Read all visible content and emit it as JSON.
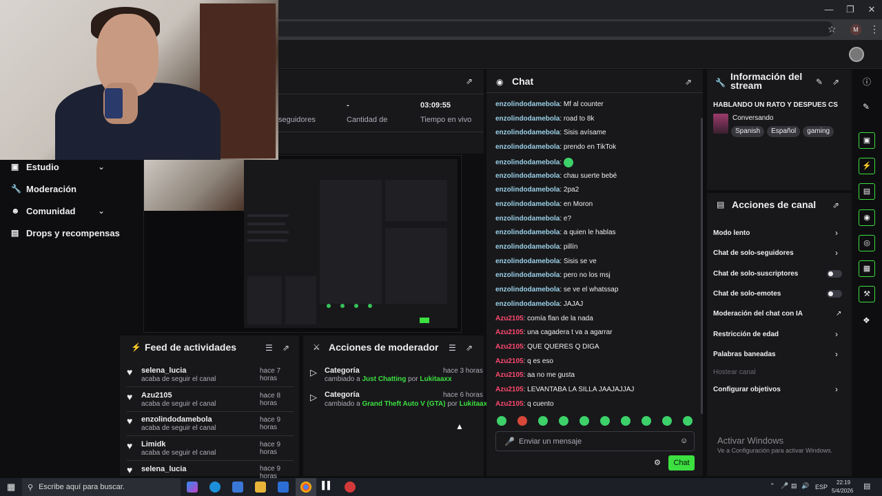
{
  "nav": {
    "items": [
      {
        "label": "Estudio",
        "icon": "film-icon",
        "chevron": true
      },
      {
        "label": "Moderación",
        "icon": "wrench-icon",
        "chevron": false
      },
      {
        "label": "Comunidad",
        "icon": "people-icon",
        "chevron": true
      },
      {
        "label": "Drops y recompensas",
        "icon": "chart-icon",
        "chevron": false
      }
    ]
  },
  "stats": {
    "followers_label": "seguidores",
    "subs_value": "-",
    "subs_label": "Cantidad de suscripciones",
    "live_time": "03:09:55",
    "live_label": "Tiempo en vivo"
  },
  "feed": {
    "title": "Feed de actividades",
    "items": [
      {
        "name": "selena_lucia",
        "action": "acaba de seguir el canal",
        "time": "hace 7 horas"
      },
      {
        "name": "Azu2105",
        "action": "acaba de seguir el canal",
        "time": "hace 8 horas"
      },
      {
        "name": "enzolindodamebola",
        "action": "acaba de seguir el canal",
        "time": "hace 9 horas"
      },
      {
        "name": "Limidk",
        "action": "acaba de seguir el canal",
        "time": "hace 9 horas"
      },
      {
        "name": "selena_lucia",
        "action": "",
        "time": "hace 9 horas"
      }
    ]
  },
  "modactions": {
    "title": "Acciones de moderador",
    "items": [
      {
        "type": "Categoría",
        "prefix": "cambiado a ",
        "target": "Just Chatting",
        "by": " por ",
        "mod": "Lukitaaxx",
        "time": "hace 3 horas"
      },
      {
        "type": "Categoría",
        "prefix": "cambiado a ",
        "target": "Grand Theft Auto V (GTA)",
        "by": " por ",
        "mod": "Lukitaaxx",
        "time": "hace 6 horas"
      }
    ]
  },
  "chat": {
    "title": "Chat",
    "messages": [
      {
        "user": "enzolindodamebola",
        "text": "Mf al counter",
        "u": 1
      },
      {
        "user": "enzolindodamebola",
        "text": "road to 8k",
        "u": 1
      },
      {
        "user": "enzolindodamebola",
        "text": "Sisis avísame",
        "u": 1
      },
      {
        "user": "enzolindodamebola",
        "text": "prendo en TikTok",
        "u": 1
      },
      {
        "user": "enzolindodamebola",
        "text": "",
        "u": 1,
        "emote": true
      },
      {
        "user": "enzolindodamebola",
        "text": "chau suerte bebé",
        "u": 1
      },
      {
        "user": "enzolindodamebola",
        "text": "2pa2",
        "u": 1
      },
      {
        "user": "enzolindodamebola",
        "text": "en Moron",
        "u": 1
      },
      {
        "user": "enzolindodamebola",
        "text": "e?",
        "u": 1
      },
      {
        "user": "enzolindodamebola",
        "text": "a quien le hablas",
        "u": 1
      },
      {
        "user": "enzolindodamebola",
        "text": "pillín",
        "u": 1
      },
      {
        "user": "enzolindodamebola",
        "text": "Sisis se ve",
        "u": 1
      },
      {
        "user": "enzolindodamebola",
        "text": "pero no los msj",
        "u": 1
      },
      {
        "user": "enzolindodamebola",
        "text": "se ve el whatssap",
        "u": 1
      },
      {
        "user": "enzolindodamebola",
        "text": "JAJAJ",
        "u": 1
      },
      {
        "user": "Azu2105",
        "text": "comía flan de la nada",
        "u": 2
      },
      {
        "user": "Azu2105",
        "text": "una cagadera t va a agarrar",
        "u": 2
      },
      {
        "user": "Azu2105",
        "text": "QUE QUERES Q DIGA",
        "u": 2
      },
      {
        "user": "Azu2105",
        "text": "q es eso",
        "u": 2
      },
      {
        "user": "Azu2105",
        "text": "aa no me gusta",
        "u": 2
      },
      {
        "user": "Azu2105",
        "text": "LEVANTABA LA SILLA JAAJAJJAJ",
        "u": 2
      },
      {
        "user": "Azu2105",
        "text": "q cuento",
        "u": 2
      }
    ],
    "input_placeholder": "Enviar un mensaje",
    "send_label": "Chat"
  },
  "info": {
    "title": "Información del stream",
    "stream_title": "HABLANDO UN RATO Y DESPUES CS",
    "category": "Conversando",
    "tags": [
      "Spanish",
      "Español",
      "gaming"
    ]
  },
  "channel_actions": {
    "title": "Acciones de canal",
    "items": [
      {
        "label": "Modo lento",
        "control": "chevron"
      },
      {
        "label": "Chat de solo-seguidores",
        "control": "chevron"
      },
      {
        "label": "Chat de solo-suscriptores",
        "control": "toggle"
      },
      {
        "label": "Chat de solo-emotes",
        "control": "toggle"
      },
      {
        "label": "Moderación del chat con IA",
        "control": "external"
      },
      {
        "label": "Restricción de edad",
        "control": "chevron"
      },
      {
        "label": "Palabras baneadas",
        "control": "chevron"
      },
      {
        "label": "Hostear canal",
        "control": "none",
        "disabled": true
      },
      {
        "label": "Configurar objetivos",
        "control": "chevron"
      }
    ]
  },
  "watermark": {
    "line1": "Activar Windows",
    "line2": "Ve a Configuración para activar Windows."
  },
  "taskbar": {
    "search_placeholder": "Escribe aquí para buscar.",
    "lang": "ESP",
    "time": "22:19",
    "date": "5/4/2026"
  },
  "browser": {
    "profile_initial": "M"
  }
}
